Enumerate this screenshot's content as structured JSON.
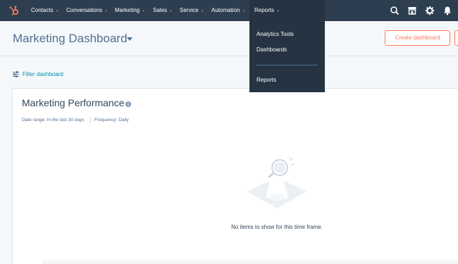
{
  "nav": {
    "items": [
      {
        "label": "Contacts"
      },
      {
        "label": "Conversations"
      },
      {
        "label": "Marketing"
      },
      {
        "label": "Sales"
      },
      {
        "label": "Service"
      },
      {
        "label": "Automation"
      },
      {
        "label": "Reports"
      }
    ],
    "chevron": "⌄"
  },
  "dropdown": {
    "items": [
      {
        "label": "Analytics Tools"
      },
      {
        "label": "Dashboards"
      },
      {
        "label": "Reports"
      }
    ]
  },
  "header": {
    "title": "Marketing Dashboard",
    "create_button": "Create dashboard"
  },
  "filter": {
    "label": "Filter dashboard"
  },
  "card": {
    "title": "Marketing Performance",
    "date_range": "Date range: In the last 30 days",
    "frequency": "Frequency: Daily",
    "empty_message": "No items to show for this time frame."
  },
  "colors": {
    "nav_bg": "#2d3e50",
    "dropdown_bg": "#253342",
    "accent": "#ff7a59",
    "link": "#0091ae"
  },
  "icons": [
    "hubspot-logo",
    "search-icon",
    "marketplace-icon",
    "gear-icon",
    "bell-icon",
    "chevron-down-icon",
    "filter-icon",
    "info-icon",
    "magnifier-illustration"
  ]
}
